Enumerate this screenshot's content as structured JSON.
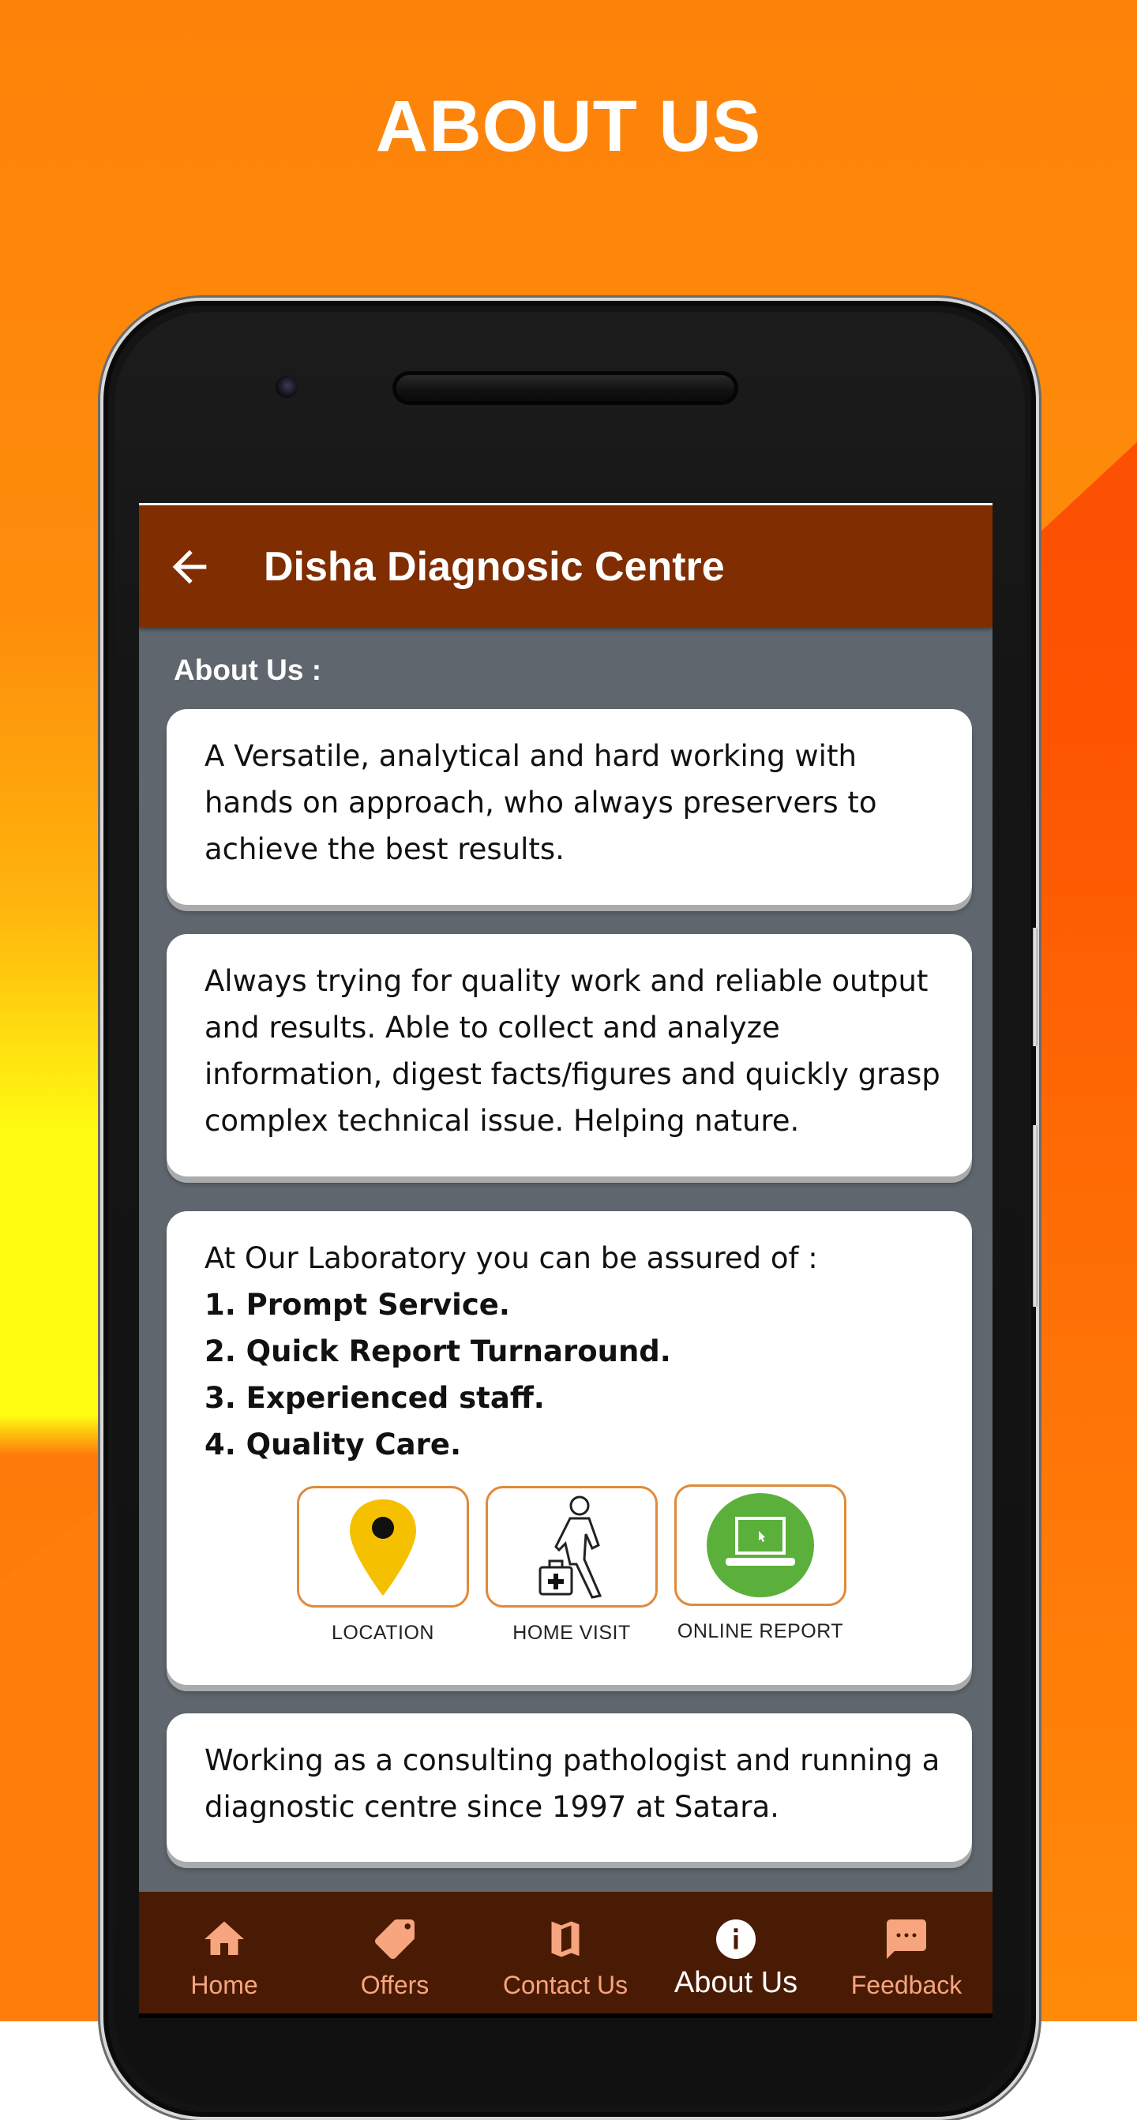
{
  "page": {
    "headline": "ABOUT US"
  },
  "colors": {
    "appbar": "#7f2d01",
    "content_bg": "#5f666d",
    "nav_bg": "#4a1b04",
    "nav_inactive": "#f6a57f",
    "nav_active": "#ffffff",
    "feature_border": "#e08a3a"
  },
  "appbar": {
    "back_icon": "arrow-left-icon",
    "title": "Disha Diagnosic Centre"
  },
  "content": {
    "section_label": "About Us :",
    "card1": {
      "text": "A Versatile, analytical and hard working with hands on approach, who always preservers to achieve the best results."
    },
    "card2": {
      "text": "Always trying for quality work and reliable output and results. Able to collect and analyze information, digest facts/figures and quickly grasp complex technical issue. Helping nature."
    },
    "card3": {
      "intro": "At Our Laboratory you can be assured of :",
      "items": [
        "1. Prompt Service.",
        "2. Quick Report Turnaround.",
        "3. Experienced staff.",
        "4. Quality Care."
      ],
      "features": [
        {
          "label": "LOCATION",
          "icon": "map-pin-icon"
        },
        {
          "label": "HOME VISIT",
          "icon": "doctor-home-visit-icon"
        },
        {
          "label": "ONLINE REPORT",
          "icon": "laptop-icon"
        }
      ]
    },
    "card4": {
      "text": "Working as a consulting pathologist and running a diagnostic centre since 1997 at Satara."
    }
  },
  "bottom_nav": {
    "active": "About Us",
    "items": [
      {
        "label": "Home",
        "icon": "home-icon"
      },
      {
        "label": "Offers",
        "icon": "tag-icon"
      },
      {
        "label": "Contact Us",
        "icon": "map-icon"
      },
      {
        "label": "About Us",
        "icon": "info-icon"
      },
      {
        "label": "Feedback",
        "icon": "chat-icon"
      }
    ]
  }
}
